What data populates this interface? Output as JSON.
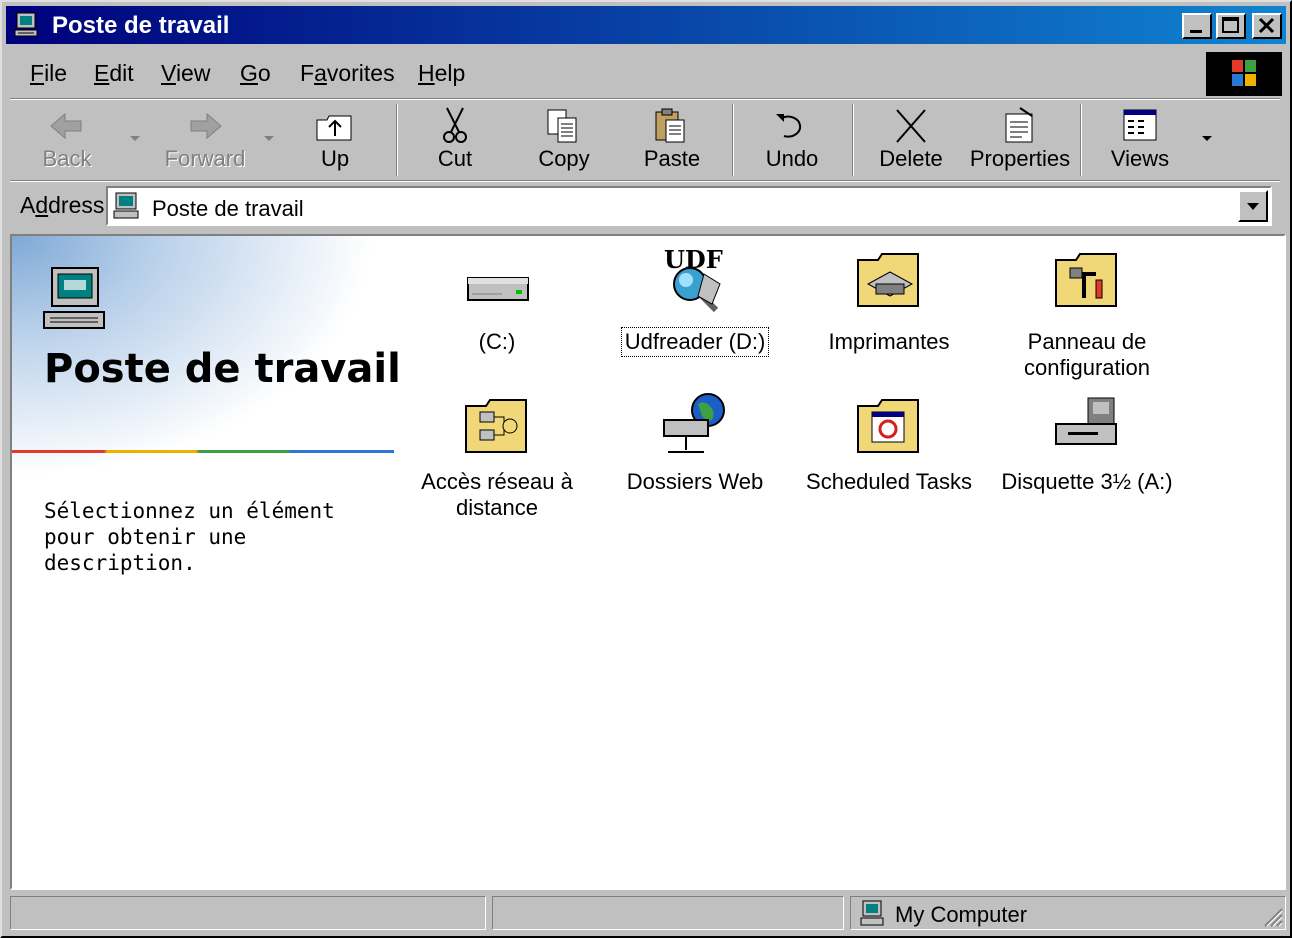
{
  "window": {
    "title": "Poste de travail",
    "controls": [
      "minimize",
      "maximize",
      "close"
    ]
  },
  "menu": {
    "items": [
      {
        "label": "File",
        "accel": "F",
        "rest": "ile"
      },
      {
        "label": "Edit",
        "accel": "E",
        "rest": "dit"
      },
      {
        "label": "View",
        "accel": "V",
        "rest": "iew"
      },
      {
        "label": "Go",
        "accel": "G",
        "rest": "o"
      },
      {
        "label": "Favorites",
        "pre": "F",
        "accel": "a",
        "rest": "vorites"
      },
      {
        "label": "Help",
        "accel": "H",
        "rest": "elp"
      }
    ]
  },
  "toolbar": {
    "back": "Back",
    "forward": "Forward",
    "up": "Up",
    "cut": "Cut",
    "copy": "Copy",
    "paste": "Paste",
    "undo": "Undo",
    "delete": "Delete",
    "properties": "Properties",
    "views": "Views"
  },
  "address": {
    "label_accel": "d",
    "label_pre": "A",
    "label_rest": "dress",
    "value": "Poste de travail"
  },
  "sidepanel": {
    "title": "Poste de travail",
    "description": "Sélectionnez un élément pour obtenir une description."
  },
  "items": [
    {
      "label": "(C:)",
      "icon": "hard-drive-icon",
      "selected": false
    },
    {
      "label": "Udfreader (D:)",
      "icon": "udf-reader-icon",
      "selected": true
    },
    {
      "label": "Imprimantes",
      "icon": "printers-folder-icon",
      "selected": false
    },
    {
      "label": "Panneau de configuration",
      "icon": "control-panel-folder-icon",
      "selected": false
    },
    {
      "label": "Accès réseau à distance",
      "icon": "dialup-networking-folder-icon",
      "selected": false
    },
    {
      "label": "Dossiers Web",
      "icon": "web-folders-icon",
      "selected": false
    },
    {
      "label": "Scheduled Tasks",
      "icon": "scheduled-tasks-folder-icon",
      "selected": false
    },
    {
      "label": "Disquette 3½ (A:)",
      "icon": "floppy-drive-icon",
      "selected": false
    }
  ],
  "status": {
    "zone": "My Computer"
  },
  "colors": {
    "titlebar_start": "#00007b",
    "titlebar_end": "#1084d0",
    "face": "#c0c0c0"
  }
}
